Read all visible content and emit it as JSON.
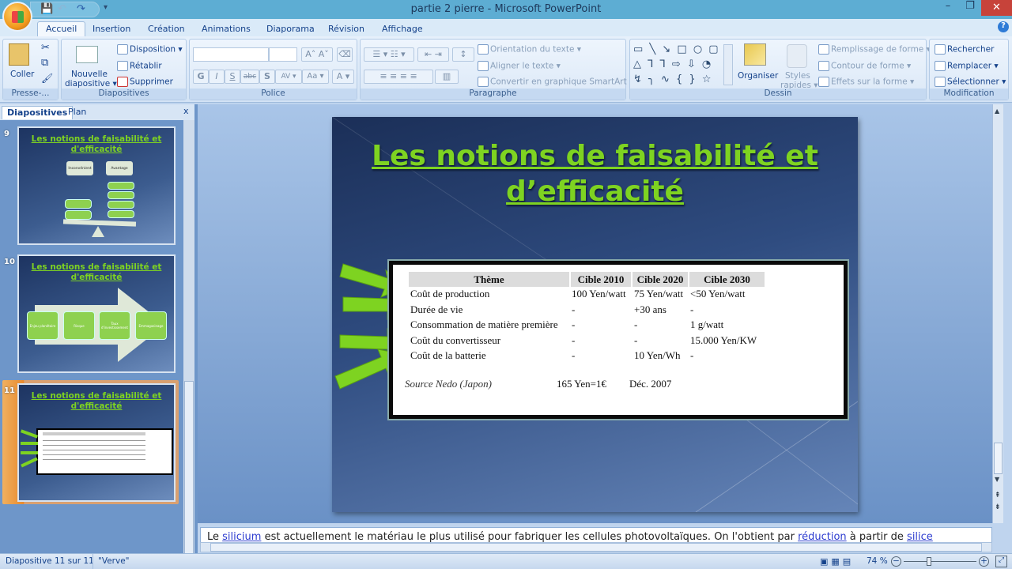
{
  "window": {
    "title": "partie 2 pierre - Microsoft PowerPoint",
    "minimize": "–",
    "restore": "❐",
    "close": "✕"
  },
  "qat": {
    "save": "💾",
    "undo": "↶",
    "redo": "↷",
    "customize": "▾"
  },
  "tabs": [
    "Accueil",
    "Insertion",
    "Création",
    "Animations",
    "Diaporama",
    "Révision",
    "Affichage"
  ],
  "ribbon": {
    "clipboard": {
      "paste": "Coller",
      "label": "Presse-...",
      "cut": "✂",
      "copy": "⧉",
      "format": "🖌"
    },
    "slides": {
      "new_slide_1": "Nouvelle",
      "new_slide_2": "diapositive ▾",
      "layout": "Disposition ▾",
      "reset": "Rétablir",
      "delete": "Supprimer",
      "label": "Diapositives"
    },
    "font": {
      "label": "Police",
      "bold": "G",
      "italic": "I",
      "underline": "S",
      "strike": "abc",
      "shadow": "S",
      "spacing": "AV ▾",
      "case": "Aa ▾",
      "color": "A ▾",
      "grow": "A˄",
      "shrink": "A˅"
    },
    "paragraph": {
      "label": "Paragraphe",
      "text_direction": "Orientation du texte ▾",
      "align_text": "Aligner le texte ▾",
      "smartart": "Convertir en graphique SmartArt ▾"
    },
    "drawing": {
      "label": "Dessin",
      "arrange": "Organiser",
      "styles_1": "Styles",
      "styles_2": "rapides ▾",
      "fill": "Remplissage de forme ▾",
      "outline": "Contour de forme ▾",
      "effects": "Effets sur la forme ▾",
      "shapes": "▭ ╲ ↘ □ ○ ▢ △ ⅂ ⅂ ⇨ ⇩ ◔ ↯ ╮ ∿ { } ☆"
    },
    "editing": {
      "label": "Modification",
      "find": "Rechercher",
      "replace": "Remplacer ▾",
      "select": "Sélectionner ▾"
    }
  },
  "pane": {
    "tab_slides": "Diapositives",
    "tab_outline": "Plan",
    "close": "x"
  },
  "thumbnails": [
    {
      "number": "9",
      "title": "Les notions de faisabilité et d'efficacité",
      "left": "Inconvénient",
      "right": "Avantage"
    },
    {
      "number": "10",
      "title": "Les notions de faisabilité et d'efficacité",
      "steps": [
        "Enjeu planétaire",
        "Risque",
        "Taux d'investissement",
        "Emmagasinage"
      ]
    },
    {
      "number": "11",
      "title": "Les notions de faisabilité et d'efficacité"
    }
  ],
  "slide": {
    "title_line1": "Les notions de faisabilité et",
    "title_line2": "d’efficacité",
    "table": {
      "headers": [
        "Thème",
        "Cible 2010",
        "Cible 2020",
        "Cible 2030"
      ],
      "rows": [
        [
          "Coût de production",
          "100 Yen/watt",
          "75 Yen/watt",
          "<50 Yen/watt"
        ],
        [
          "Durée de vie",
          "-",
          "+30 ans",
          "-"
        ],
        [
          "Consommation de matière première",
          "-",
          "-",
          "1 g/watt"
        ],
        [
          "Coût du convertisseur",
          "-",
          "-",
          "15.000 Yen/KW"
        ],
        [
          "Coût de la batterie",
          "-",
          "10 Yen/Wh",
          "-"
        ]
      ],
      "source": "Source Nedo (Japon)",
      "rate": "165 Yen=1€",
      "date": "Déc. 2007"
    }
  },
  "notes": {
    "t1": "Le ",
    "l1": "silicium",
    "t2": " est actuellement le matériau le plus utilisé pour fabriquer les cellules photovoltaïques. On l'obtient par ",
    "l2": "réduction",
    "t3": " à partir de ",
    "l3": "silice"
  },
  "status": {
    "slide": "Diapositive 11 sur 11",
    "theme": "\"Verve\"",
    "zoom": "74 %",
    "zoom_percent": 74
  }
}
